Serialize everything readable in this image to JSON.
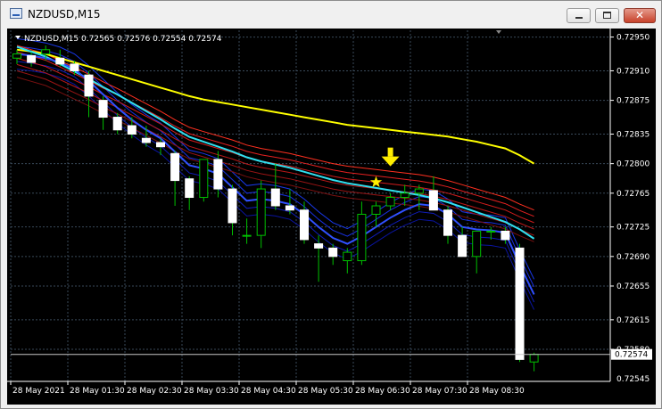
{
  "window": {
    "title": "NZDUSD,M15",
    "minimize_icon": "minimize-icon",
    "maximize_icon": "maximize-icon",
    "close_icon": "close-icon"
  },
  "colors": {
    "background": "#000000",
    "grid": "#3a4a5a",
    "axis_text": "#ffffff",
    "bull_candle": "#ffffff",
    "bear_candle": "#000000",
    "wick": "#00c000",
    "fast_ribbon": "#1428d8",
    "slow_ribbon": "#e02020",
    "yellow_line": "#ffff00",
    "cyan_line": "#30e0f0",
    "signal": "#ffee00"
  },
  "chart_data": {
    "type": "candlestick",
    "symbol_header": "NZDUSD,M15  0.72565 0.72576 0.72554 0.72574",
    "y_ticks": [
      "0.72950",
      "0.72910",
      "0.72875",
      "0.72835",
      "0.72800",
      "0.72765",
      "0.72725",
      "0.72690",
      "0.72655",
      "0.72615",
      "0.72580"
    ],
    "y_tick_values": [
      0.7295,
      0.7291,
      0.72875,
      0.72835,
      0.728,
      0.72765,
      0.72725,
      0.7269,
      0.72655,
      0.72615,
      0.7258
    ],
    "last_price_label": "0.72574",
    "last_price": 0.72574,
    "min_label": "0.72545",
    "ylim": [
      0.72542,
      0.72958
    ],
    "x_ticks": [
      "28 May 2021",
      "28 May 01:30",
      "28 May 02:30",
      "28 May 03:30",
      "28 May 04:30",
      "28 May 05:30",
      "28 May 06:30",
      "28 May 07:30",
      "28 May 08:30"
    ],
    "candles": [
      {
        "o": 0.72925,
        "h": 0.72935,
        "l": 0.72918,
        "c": 0.7293
      },
      {
        "o": 0.72928,
        "h": 0.72932,
        "l": 0.72915,
        "c": 0.7292
      },
      {
        "o": 0.7293,
        "h": 0.7294,
        "l": 0.72922,
        "c": 0.72935
      },
      {
        "o": 0.72925,
        "h": 0.72935,
        "l": 0.72915,
        "c": 0.72918
      },
      {
        "o": 0.72918,
        "h": 0.72922,
        "l": 0.72905,
        "c": 0.7291
      },
      {
        "o": 0.72905,
        "h": 0.7291,
        "l": 0.72855,
        "c": 0.7288
      },
      {
        "o": 0.72875,
        "h": 0.7288,
        "l": 0.7284,
        "c": 0.72855
      },
      {
        "o": 0.72855,
        "h": 0.7286,
        "l": 0.72835,
        "c": 0.7284
      },
      {
        "o": 0.72845,
        "h": 0.72855,
        "l": 0.7283,
        "c": 0.72835
      },
      {
        "o": 0.7283,
        "h": 0.72845,
        "l": 0.7282,
        "c": 0.72825
      },
      {
        "o": 0.72825,
        "h": 0.7283,
        "l": 0.7281,
        "c": 0.7282
      },
      {
        "o": 0.72812,
        "h": 0.72815,
        "l": 0.7275,
        "c": 0.7278
      },
      {
        "o": 0.72782,
        "h": 0.72785,
        "l": 0.72745,
        "c": 0.7276
      },
      {
        "o": 0.7276,
        "h": 0.72805,
        "l": 0.72755,
        "c": 0.72805
      },
      {
        "o": 0.72805,
        "h": 0.72815,
        "l": 0.7276,
        "c": 0.7277
      },
      {
        "o": 0.7277,
        "h": 0.72775,
        "l": 0.72715,
        "c": 0.7273
      },
      {
        "o": 0.72715,
        "h": 0.72735,
        "l": 0.72705,
        "c": 0.72715
      },
      {
        "o": 0.72715,
        "h": 0.7278,
        "l": 0.727,
        "c": 0.7277
      },
      {
        "o": 0.7277,
        "h": 0.728,
        "l": 0.72745,
        "c": 0.7275
      },
      {
        "o": 0.7275,
        "h": 0.7277,
        "l": 0.7274,
        "c": 0.72745
      },
      {
        "o": 0.72745,
        "h": 0.72755,
        "l": 0.72705,
        "c": 0.7271
      },
      {
        "o": 0.72705,
        "h": 0.72715,
        "l": 0.7266,
        "c": 0.727
      },
      {
        "o": 0.727,
        "h": 0.72705,
        "l": 0.7268,
        "c": 0.7269
      },
      {
        "o": 0.72685,
        "h": 0.727,
        "l": 0.7267,
        "c": 0.72695
      },
      {
        "o": 0.72685,
        "h": 0.72755,
        "l": 0.7268,
        "c": 0.7274
      },
      {
        "o": 0.7274,
        "h": 0.72755,
        "l": 0.72725,
        "c": 0.7275
      },
      {
        "o": 0.7275,
        "h": 0.72765,
        "l": 0.72745,
        "c": 0.7276
      },
      {
        "o": 0.7276,
        "h": 0.72775,
        "l": 0.7275,
        "c": 0.72765
      },
      {
        "o": 0.72765,
        "h": 0.72775,
        "l": 0.72745,
        "c": 0.7277
      },
      {
        "o": 0.72768,
        "h": 0.72785,
        "l": 0.72745,
        "c": 0.72745
      },
      {
        "o": 0.72745,
        "h": 0.7275,
        "l": 0.72705,
        "c": 0.72715
      },
      {
        "o": 0.72715,
        "h": 0.72725,
        "l": 0.7269,
        "c": 0.7269
      },
      {
        "o": 0.7269,
        "h": 0.7272,
        "l": 0.7267,
        "c": 0.7272
      },
      {
        "o": 0.7272,
        "h": 0.72725,
        "l": 0.7271,
        "c": 0.7272
      },
      {
        "o": 0.7272,
        "h": 0.72725,
        "l": 0.72705,
        "c": 0.7271
      },
      {
        "o": 0.727,
        "h": 0.72705,
        "l": 0.72565,
        "c": 0.72568
      },
      {
        "o": 0.72565,
        "h": 0.72576,
        "l": 0.72554,
        "c": 0.72574
      }
    ],
    "ma_fast": [
      0.7293,
      0.72928,
      0.72925,
      0.7292,
      0.72912,
      0.72898,
      0.72882,
      0.72866,
      0.72852,
      0.7284,
      0.7283,
      0.72814,
      0.72798,
      0.72794,
      0.72788,
      0.72772,
      0.72756,
      0.72758,
      0.72756,
      0.72752,
      0.7274,
      0.72725,
      0.72712,
      0.72705,
      0.72714,
      0.72725,
      0.72736,
      0.72745,
      0.72752,
      0.7275,
      0.7274,
      0.72725,
      0.72722,
      0.72721,
      0.72718,
      0.7268,
      0.72645
    ],
    "ma_slow": [
      0.7294,
      0.72935,
      0.7293,
      0.72922,
      0.72914,
      0.72906,
      0.72897,
      0.72889,
      0.7288,
      0.72871,
      0.72862,
      0.72852,
      0.72843,
      0.72838,
      0.72833,
      0.72828,
      0.72822,
      0.72818,
      0.72815,
      0.72812,
      0.72808,
      0.72804,
      0.728,
      0.72797,
      0.72795,
      0.72793,
      0.72791,
      0.72789,
      0.72787,
      0.72784,
      0.7278,
      0.72775,
      0.7277,
      0.72765,
      0.7276,
      0.72752,
      0.72745
    ],
    "ma_yellow": [
      0.72935,
      0.72933,
      0.7293,
      0.72925,
      0.7292,
      0.72915,
      0.7291,
      0.72905,
      0.729,
      0.72895,
      0.7289,
      0.72885,
      0.7288,
      0.72876,
      0.72873,
      0.7287,
      0.72867,
      0.72864,
      0.72861,
      0.72858,
      0.72855,
      0.72852,
      0.72849,
      0.72846,
      0.72844,
      0.72842,
      0.7284,
      0.72838,
      0.72836,
      0.72834,
      0.72832,
      0.72829,
      0.72826,
      0.72822,
      0.72818,
      0.7281,
      0.728
    ],
    "ribbon_spread_fast": 9e-05,
    "ribbon_spread_slow": 7.5e-05,
    "signals": [
      {
        "type": "star",
        "index": 25,
        "price": 0.72778
      },
      {
        "type": "arrow-down",
        "index": 26,
        "price": 0.728
      }
    ]
  }
}
